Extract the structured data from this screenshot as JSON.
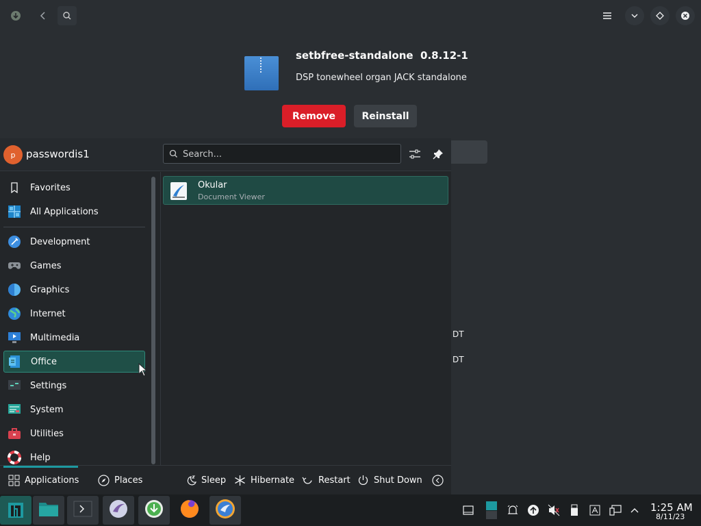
{
  "package": {
    "name": "setbfree-standalone",
    "version": "0.8.12-1",
    "description": "DSP tonewheel organ JACK standalone",
    "remove_label": "Remove",
    "reinstall_label": "Reinstall",
    "background_text_1": "DT",
    "background_text_2": "DT"
  },
  "launcher": {
    "username": "passwordis1",
    "avatar_letter": "p",
    "search_placeholder": "Search...",
    "categories": [
      {
        "label": "Favorites",
        "icon": "bookmark-icon"
      },
      {
        "label": "All Applications",
        "icon": "grid-icon"
      },
      {
        "label": "Development",
        "icon": "development-icon"
      },
      {
        "label": "Games",
        "icon": "gamepad-icon"
      },
      {
        "label": "Graphics",
        "icon": "graphics-icon"
      },
      {
        "label": "Internet",
        "icon": "globe-icon"
      },
      {
        "label": "Multimedia",
        "icon": "multimedia-icon"
      },
      {
        "label": "Office",
        "icon": "office-icon"
      },
      {
        "label": "Settings",
        "icon": "settings-icon"
      },
      {
        "label": "System",
        "icon": "system-icon"
      },
      {
        "label": "Utilities",
        "icon": "toolbox-icon"
      },
      {
        "label": "Help",
        "icon": "lifebuoy-icon"
      }
    ],
    "active_category": "Office",
    "results": [
      {
        "name": "Okular",
        "description": "Document Viewer",
        "icon": "okular-icon"
      }
    ],
    "footer": {
      "applications": "Applications",
      "places": "Places",
      "sleep": "Sleep",
      "hibernate": "Hibernate",
      "restart": "Restart",
      "shutdown": "Shut Down"
    }
  },
  "taskbar": {
    "time": "1:25 AM",
    "date": "8/11/23"
  },
  "colors": {
    "accent": "#1d99a0",
    "remove": "#da1e28",
    "active_item": "#1f4f47"
  }
}
